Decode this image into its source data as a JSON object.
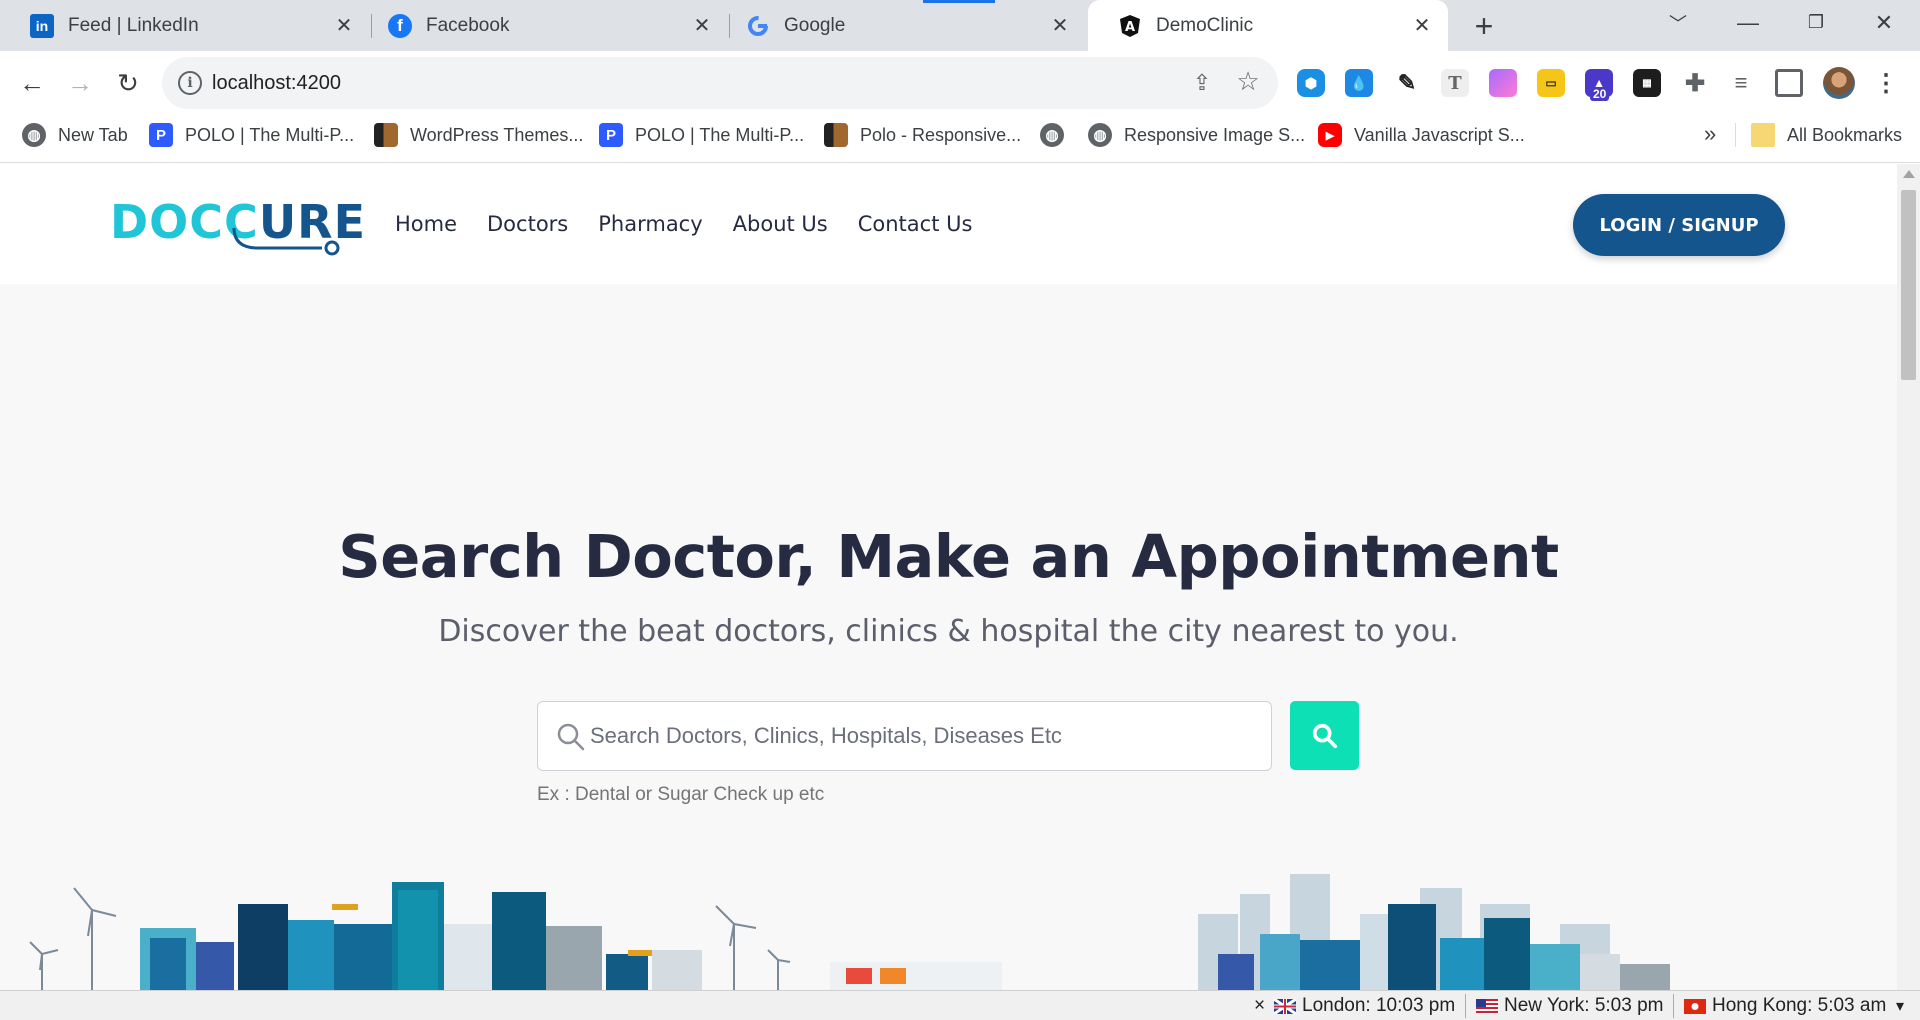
{
  "browser": {
    "tabs": [
      {
        "title": "Feed | LinkedIn",
        "icon": "linkedin-icon",
        "active": false
      },
      {
        "title": "Facebook",
        "icon": "facebook-icon",
        "active": false
      },
      {
        "title": "Google",
        "icon": "google-icon",
        "active": false
      },
      {
        "title": "DemoClinic",
        "icon": "angular-icon",
        "active": true
      }
    ],
    "url": "localhost:4200",
    "extension_badge": "20",
    "bookmarks": [
      {
        "label": "New Tab",
        "icon": "globe-icon"
      },
      {
        "label": "POLO | The Multi-P...",
        "icon": "polo-icon"
      },
      {
        "label": "WordPress Themes...",
        "icon": "themeforest-icon"
      },
      {
        "label": "POLO | The Multi-P...",
        "icon": "polo-icon"
      },
      {
        "label": "Polo - Responsive...",
        "icon": "themeforest-icon"
      },
      {
        "label": "",
        "icon": "globe-icon"
      },
      {
        "label": "Responsive Image S...",
        "icon": "globe-icon"
      },
      {
        "label": "Vanilla Javascript S...",
        "icon": "youtube-icon"
      }
    ],
    "bookmarks_overflow": "»",
    "all_bookmarks": "All Bookmarks"
  },
  "site": {
    "logo_part1": "DOCC",
    "logo_part2": "URE",
    "nav": [
      "Home",
      "Doctors",
      "Pharmacy",
      "About Us",
      "Contact Us"
    ],
    "login_label": "LOGIN / SIGNUP",
    "hero_title": "Search Doctor, Make an Appointment",
    "hero_subtitle": "Discover the beat doctors, clinics & hospital the city nearest to you.",
    "search_placeholder": "Search Doctors, Clinics, Hospitals, Diseases Etc",
    "search_hint": "Ex : Dental or Sugar Check up etc"
  },
  "status_bar": {
    "close": "×",
    "clocks": [
      {
        "city": "London: 10:03 pm",
        "flag": "uk-flag-icon"
      },
      {
        "city": "New York: 5:03 pm",
        "flag": "us-flag-icon"
      },
      {
        "city": "Hong Kong: 5:03 am",
        "flag": "hk-flag-icon"
      }
    ],
    "menu": "▾"
  },
  "colors": {
    "brand_primary": "#15558d",
    "brand_accent": "#20c5d8",
    "search_button": "#0ce0b4",
    "page_bg": "#f8f8f8"
  }
}
